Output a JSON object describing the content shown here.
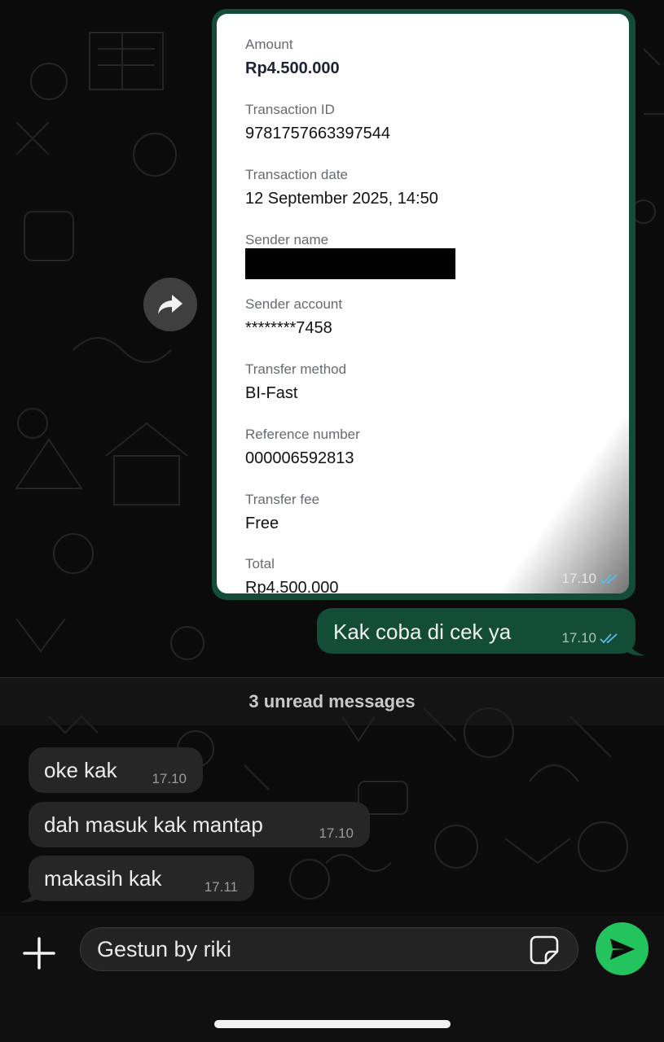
{
  "receipt": {
    "fields": [
      {
        "label": "Amount",
        "value": "Rp4.500.000"
      },
      {
        "label": "Transaction ID",
        "value": "9781757663397544"
      },
      {
        "label": "Transaction date",
        "value": "12 September 2025, 14:50"
      },
      {
        "label": "Sender name",
        "value": ""
      },
      {
        "label": "Sender account",
        "value": "********7458"
      },
      {
        "label": "Transfer method",
        "value": "BI-Fast"
      },
      {
        "label": "Reference number",
        "value": "000006592813"
      },
      {
        "label": "Transfer fee",
        "value": "Free"
      },
      {
        "label": "Total",
        "value": "Rp4.500.000"
      }
    ],
    "time": "17.10"
  },
  "outgoing": {
    "text": "Kak coba di cek ya",
    "time": "17.10"
  },
  "divider": {
    "label": "3 unread messages"
  },
  "incoming": [
    {
      "text": "oke kak",
      "time": "17.10"
    },
    {
      "text": "dah masuk kak mantap",
      "time": "17.10"
    },
    {
      "text": "makasih kak",
      "time": "17.11"
    }
  ],
  "composer": {
    "value": "Gestun by riki"
  },
  "colors": {
    "outgoing_bubble": "#144d37",
    "incoming_bubble": "#262626",
    "send_button": "#23c45e",
    "read_ticks": "#53bdeb"
  },
  "icons": [
    "forward-icon",
    "double-check-icon",
    "plus-icon",
    "sticker-icon",
    "send-icon"
  ]
}
